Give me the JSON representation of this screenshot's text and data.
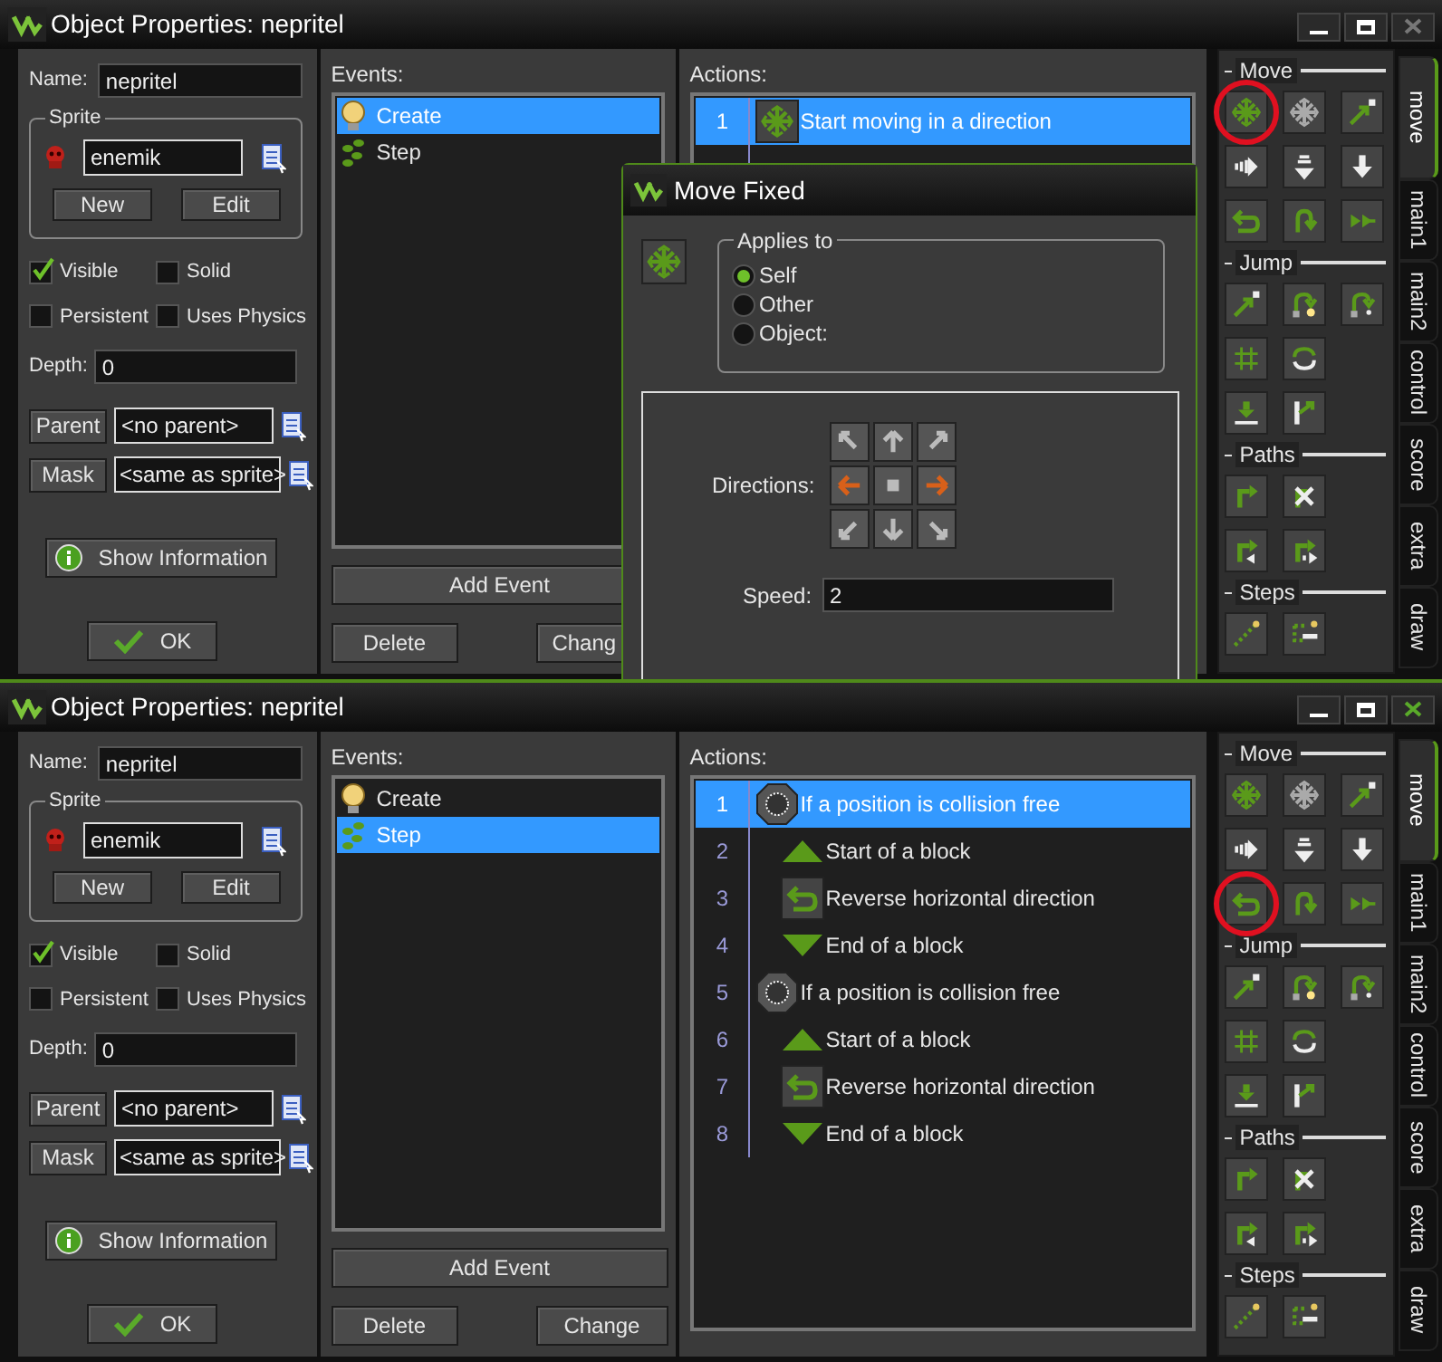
{
  "windows": [
    {
      "title": "Object Properties: nepritel",
      "active": false,
      "name_label": "Name:",
      "name_value": "nepritel",
      "sprite": {
        "label": "Sprite",
        "value": "enemik",
        "new_button": "New",
        "edit_button": "Edit"
      },
      "options": [
        {
          "label": "Visible",
          "checked": true
        },
        {
          "label": "Solid",
          "checked": false
        },
        {
          "label": "Persistent",
          "checked": false
        },
        {
          "label": "Uses Physics",
          "checked": false
        }
      ],
      "depth": {
        "label": "Depth:",
        "value": "0"
      },
      "parent": {
        "button": "Parent",
        "value": "<no parent>"
      },
      "mask": {
        "button": "Mask",
        "value": "<same as sprite>"
      },
      "show_info": "Show Information",
      "ok": "OK",
      "events_label": "Events:",
      "events": [
        {
          "kind": "create",
          "label": "Create",
          "selected": true
        },
        {
          "kind": "step",
          "label": "Step",
          "selected": false
        }
      ],
      "add_event": "Add Event",
      "delete": "Delete",
      "change": "Chang",
      "actions_label": "Actions:",
      "actions": [
        {
          "number": "1",
          "kind": "move",
          "label": "Start moving in a direction",
          "selected": true
        }
      ],
      "palette": [
        {
          "label": "Move",
          "buttons": [
            {
              "circled": true
            },
            {
              "circled": false
            },
            {
              "circled": false
            },
            {
              "circled": false
            },
            {
              "circled": false
            },
            {
              "circled": false
            },
            {
              "circled": false
            },
            {
              "circled": false
            },
            {
              "circled": false
            }
          ]
        },
        {
          "label": "Jump",
          "buttons": [
            {
              "circled": false
            },
            {
              "circled": false
            },
            {
              "circled": false
            },
            {
              "circled": false
            },
            {
              "circled": false
            },
            {
              "circled": false
            },
            {
              "circled": false
            }
          ]
        },
        {
          "label": "Paths",
          "buttons": [
            {
              "circled": false
            },
            {
              "circled": false
            },
            {
              "circled": false
            },
            {
              "circled": false
            }
          ]
        },
        {
          "label": "Steps",
          "buttons": [
            {
              "circled": false
            },
            {
              "circled": false
            }
          ]
        }
      ],
      "tabs": [
        {
          "label": "move",
          "selected": true
        },
        {
          "label": "main1",
          "selected": false
        },
        {
          "label": "main2",
          "selected": false
        },
        {
          "label": "control",
          "selected": false
        },
        {
          "label": "score",
          "selected": false
        },
        {
          "label": "extra",
          "selected": false
        },
        {
          "label": "draw",
          "selected": false
        }
      ],
      "dialog": {
        "title": "Move Fixed",
        "applies_label": "Applies to",
        "applies": [
          {
            "label": "Self",
            "selected": true
          },
          {
            "label": "Other",
            "selected": false
          },
          {
            "label": "Object:",
            "selected": false
          }
        ],
        "directions_label": "Directions:",
        "directions": [
          {
            "selected": false
          },
          {
            "selected": false
          },
          {
            "selected": false
          },
          {
            "selected": true
          },
          {
            "selected": false
          },
          {
            "selected": true
          },
          {
            "selected": false
          },
          {
            "selected": false
          },
          {
            "selected": false
          }
        ],
        "speed_label": "Speed:",
        "speed_value": "2"
      }
    },
    {
      "title": "Object Properties: nepritel",
      "active": true,
      "name_label": "Name:",
      "name_value": "nepritel",
      "sprite": {
        "label": "Sprite",
        "value": "enemik",
        "new_button": "New",
        "edit_button": "Edit"
      },
      "options": [
        {
          "label": "Visible",
          "checked": true
        },
        {
          "label": "Solid",
          "checked": false
        },
        {
          "label": "Persistent",
          "checked": false
        },
        {
          "label": "Uses Physics",
          "checked": false
        }
      ],
      "depth": {
        "label": "Depth:",
        "value": "0"
      },
      "parent": {
        "button": "Parent",
        "value": "<no parent>"
      },
      "mask": {
        "button": "Mask",
        "value": "<same as sprite>"
      },
      "show_info": "Show Information",
      "ok": "OK",
      "events_label": "Events:",
      "events": [
        {
          "kind": "create",
          "label": "Create",
          "selected": false
        },
        {
          "kind": "step",
          "label": "Step",
          "selected": true
        }
      ],
      "add_event": "Add Event",
      "delete": "Delete",
      "change": "Change",
      "actions_label": "Actions:",
      "actions": [
        {
          "number": "1",
          "kind": "check",
          "label": "If a position is collision free",
          "selected": true
        },
        {
          "number": "2",
          "kind": "block_start",
          "label": "Start of a block",
          "selected": false
        },
        {
          "number": "3",
          "kind": "reverse",
          "label": "Reverse horizontal direction",
          "selected": false
        },
        {
          "number": "4",
          "kind": "block_end",
          "label": "End of a block",
          "selected": false
        },
        {
          "number": "5",
          "kind": "check",
          "label": "If a position is collision free",
          "selected": false
        },
        {
          "number": "6",
          "kind": "block_start",
          "label": "Start of a block",
          "selected": false
        },
        {
          "number": "7",
          "kind": "reverse",
          "label": "Reverse horizontal direction",
          "selected": false
        },
        {
          "number": "8",
          "kind": "block_end",
          "label": "End of a block",
          "selected": false
        }
      ],
      "palette": [
        {
          "label": "Move",
          "buttons": [
            {
              "circled": false
            },
            {
              "circled": false
            },
            {
              "circled": false
            },
            {
              "circled": false
            },
            {
              "circled": false
            },
            {
              "circled": false
            },
            {
              "circled": true
            },
            {
              "circled": false
            },
            {
              "circled": false
            }
          ]
        },
        {
          "label": "Jump",
          "buttons": [
            {
              "circled": false
            },
            {
              "circled": false
            },
            {
              "circled": false
            },
            {
              "circled": false
            },
            {
              "circled": false
            },
            {
              "circled": false
            },
            {
              "circled": false
            }
          ]
        },
        {
          "label": "Paths",
          "buttons": [
            {
              "circled": false
            },
            {
              "circled": false
            },
            {
              "circled": false
            },
            {
              "circled": false
            }
          ]
        },
        {
          "label": "Steps",
          "buttons": [
            {
              "circled": false
            },
            {
              "circled": false
            }
          ]
        }
      ],
      "tabs": [
        {
          "label": "move",
          "selected": true
        },
        {
          "label": "main1",
          "selected": false
        },
        {
          "label": "main2",
          "selected": false
        },
        {
          "label": "control",
          "selected": false
        },
        {
          "label": "score",
          "selected": false
        },
        {
          "label": "extra",
          "selected": false
        },
        {
          "label": "draw",
          "selected": false
        }
      ]
    }
  ]
}
